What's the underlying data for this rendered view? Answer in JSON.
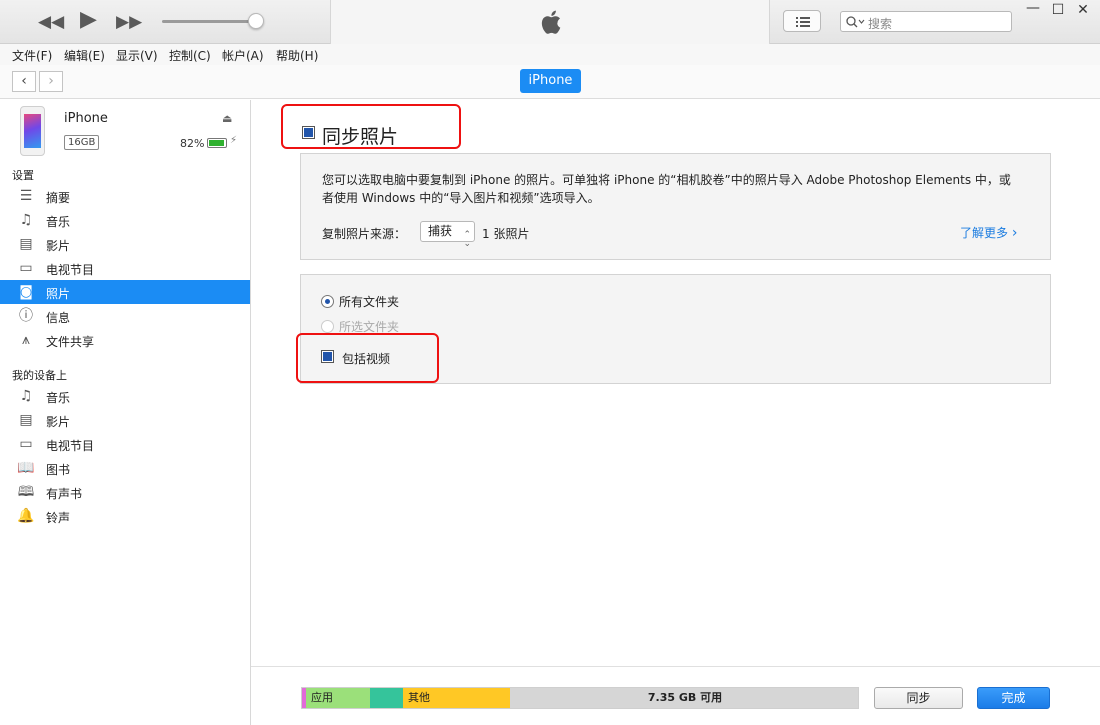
{
  "search": {
    "placeholder": "搜索"
  },
  "menu": [
    "文件(F)",
    "编辑(E)",
    "显示(V)",
    "控制(C)",
    "帐户(A)",
    "帮助(H)"
  ],
  "nav": {
    "device_pill": "iPhone"
  },
  "device": {
    "name": "iPhone",
    "capacity": "16GB",
    "battery": "82%",
    "battery_level": 0.82
  },
  "sidebar": {
    "settings_header": "设置",
    "settings_items": [
      {
        "label": "摘要",
        "icon": "summary-icon"
      },
      {
        "label": "音乐",
        "icon": "music-note-icon"
      },
      {
        "label": "影片",
        "icon": "film-icon"
      },
      {
        "label": "电视节目",
        "icon": "tv-icon"
      },
      {
        "label": "照片",
        "icon": "camera-icon",
        "selected": true
      },
      {
        "label": "信息",
        "icon": "info-icon"
      },
      {
        "label": "文件共享",
        "icon": "app-store-icon"
      }
    ],
    "ondevice_header": "我的设备上",
    "ondevice_items": [
      {
        "label": "音乐",
        "icon": "music-note-icon"
      },
      {
        "label": "影片",
        "icon": "film-icon"
      },
      {
        "label": "电视节目",
        "icon": "tv-icon"
      },
      {
        "label": "图书",
        "icon": "book-icon"
      },
      {
        "label": "有声书",
        "icon": "audiobook-icon"
      },
      {
        "label": "铃声",
        "icon": "bell-icon"
      }
    ]
  },
  "main": {
    "sync_title": "同步照片",
    "sync_checked": true,
    "description": "您可以选取电脑中要复制到 iPhone 的照片。可单独将 iPhone 的“相机胶卷”中的照片导入 Adobe Photoshop Elements 中，或者使用 Windows 中的“导入图片和视频”选项导入。",
    "source_label": "复制照片来源：",
    "source_value": "捕获",
    "source_count": "1 张照片",
    "learn_more": "了解更多",
    "options": {
      "all_folders": "所有文件夹",
      "selected_folders": "所选文件夹",
      "include_videos": "包括视频",
      "include_videos_checked": true
    }
  },
  "storage": {
    "segments": [
      {
        "label": "",
        "color": "#e26ad9"
      },
      {
        "label": "应用",
        "color": "#9be07a"
      },
      {
        "label": "",
        "color": "#35c49b"
      },
      {
        "label": "其他",
        "color": "#ffc825"
      },
      {
        "label": "7.35 GB 可用",
        "color": "#d6d6d6"
      }
    ]
  },
  "buttons": {
    "sync": "同步",
    "done": "完成"
  },
  "colors": {
    "accent": "#1b8cf4",
    "highlight": "#e11111"
  }
}
